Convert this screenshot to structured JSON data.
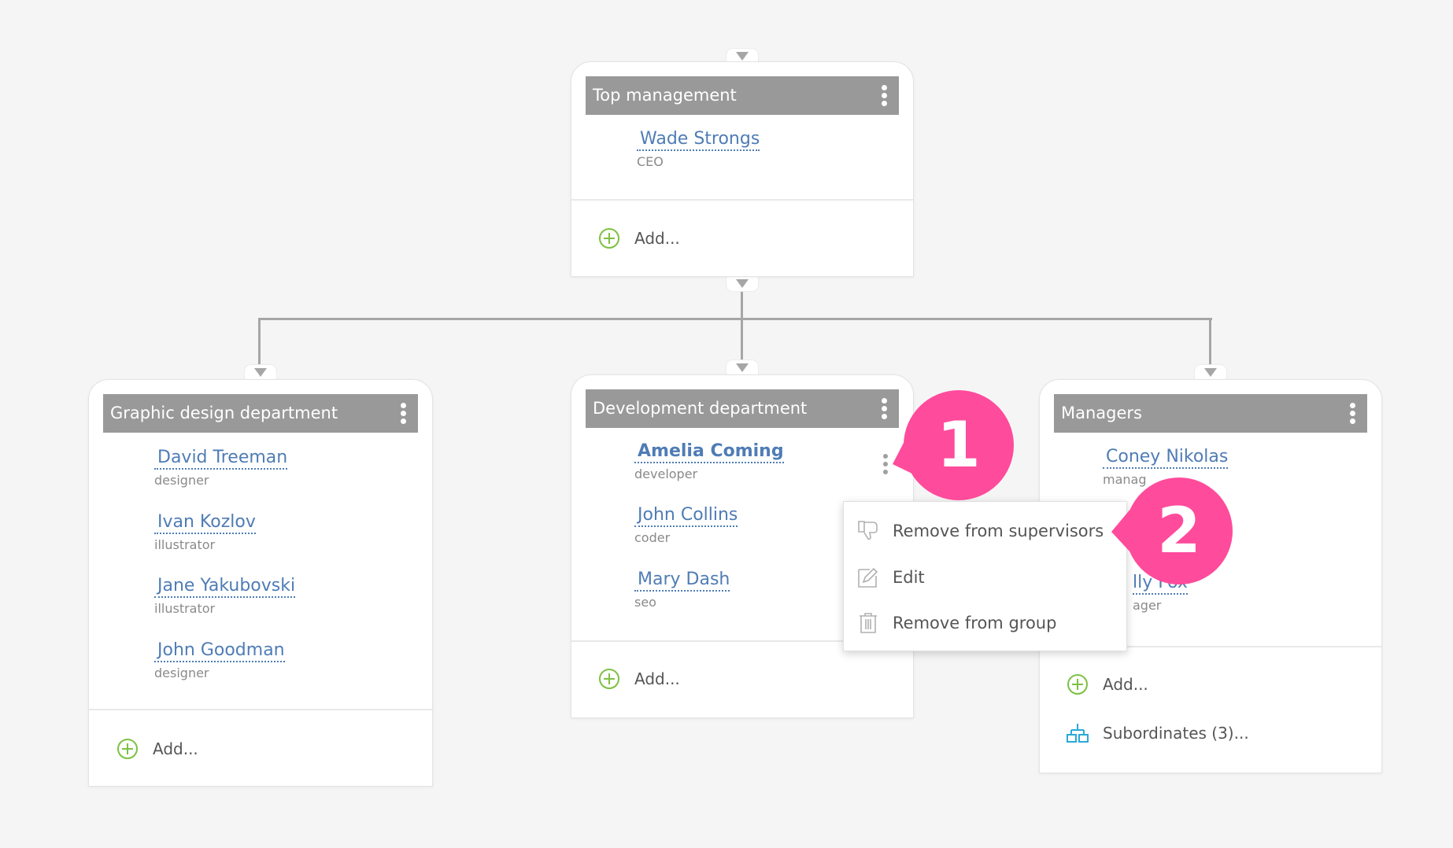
{
  "colors": {
    "background": "#f5f5f5",
    "header": "#999999",
    "link": "#4f7cb5",
    "add_icon": "#7dc142",
    "subordinates_icon": "#29a9d8",
    "callout": "#ff4b9b"
  },
  "groups": {
    "top": {
      "title": "Top management",
      "members": [
        {
          "name": "Wade Strongs",
          "role": "CEO"
        }
      ],
      "add_label": "Add..."
    },
    "graphic": {
      "title": "Graphic design department",
      "members": [
        {
          "name": "David Treeman",
          "role": "designer"
        },
        {
          "name": "Ivan Kozlov",
          "role": "illustrator"
        },
        {
          "name": "Jane Yakubovski",
          "role": "illustrator"
        },
        {
          "name": "John Goodman",
          "role": "designer"
        }
      ],
      "add_label": "Add..."
    },
    "development": {
      "title": "Development department",
      "members": [
        {
          "name": "Amelia Coming",
          "role": "developer"
        },
        {
          "name": "John Collins",
          "role": "coder"
        },
        {
          "name": "Mary Dash",
          "role": "seo"
        }
      ],
      "add_label": "Add..."
    },
    "managers": {
      "title": "Managers",
      "members": [
        {
          "name": "Coney Nikolas",
          "role": "manag"
        },
        {
          "name": "lly Fox",
          "role": "ager"
        }
      ],
      "add_label": "Add...",
      "subordinates_label": "Subordinates (3)..."
    }
  },
  "context_menu": {
    "items": [
      {
        "label": "Remove from supervisors",
        "icon": "thumbs-down-icon"
      },
      {
        "label": "Edit",
        "icon": "edit-icon"
      },
      {
        "label": "Remove from group",
        "icon": "trash-icon"
      }
    ]
  },
  "callouts": [
    {
      "number": "1"
    },
    {
      "number": "2"
    }
  ]
}
